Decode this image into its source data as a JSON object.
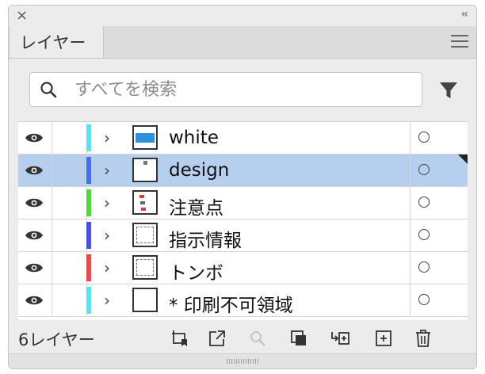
{
  "panel": {
    "tab_label": "レイヤー",
    "search_placeholder": "すべてを検索",
    "layer_count_label": "6レイヤー"
  },
  "layers": [
    {
      "name": "white",
      "color": "#5ee0f2",
      "thumb": "white",
      "selected": false
    },
    {
      "name": "design",
      "color": "#4a6cf0",
      "thumb": "design",
      "selected": true
    },
    {
      "name": "注意点",
      "color": "#4fdc3a",
      "thumb": "note",
      "selected": false
    },
    {
      "name": "指示情報",
      "color": "#4a4ff0",
      "thumb": "dashed",
      "selected": false
    },
    {
      "name": "トンボ",
      "color": "#f04848",
      "thumb": "dashed",
      "selected": false
    },
    {
      "name": "* 印刷不可領域",
      "color": "#5ee0f2",
      "thumb": "blank",
      "selected": false
    }
  ],
  "icons": {
    "close": "close-icon",
    "collapse": "double-chevron-left-icon",
    "menu": "hamburger-menu-icon",
    "search": "search-icon",
    "filter": "filter-icon",
    "visibility": "eye-icon",
    "expand": "chevron-right-icon",
    "target": "target-circle-icon",
    "footer_buttons": [
      "artboard-collect-icon",
      "export-icon",
      "locate-object-icon",
      "clipping-mask-icon",
      "new-sublayer-icon",
      "new-layer-icon",
      "trash-icon"
    ]
  }
}
